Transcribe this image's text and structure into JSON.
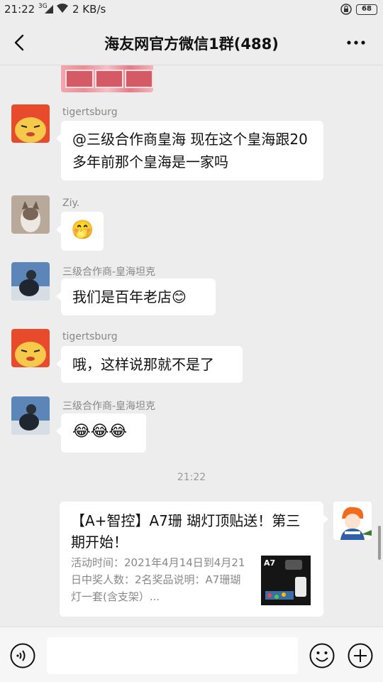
{
  "status_bar": {
    "time": "21:22",
    "network": "3G",
    "speed": "2 KB/s",
    "battery": "68"
  },
  "header": {
    "title": "海友网官方微信1群(488)"
  },
  "messages": [
    {
      "sender": "tigertsburg",
      "text": "@三级合作商皇海  现在这个皇海跟20 多年前那个皇海是一家吗"
    },
    {
      "sender": "Ziy.",
      "text": "🤭"
    },
    {
      "sender": "三级合作商-皇海坦克",
      "text": "我们是百年老店😊"
    },
    {
      "sender": "tigertsburg",
      "text": "哦，这样说那就不是了"
    },
    {
      "sender": "三级合作商-皇海坦克",
      "text": "😂😂😂"
    }
  ],
  "timestamp": "21:22",
  "share_card": {
    "title": "【A+智控】A7珊 瑚灯顶贴送！第三期开始！",
    "description": "活动时间：2021年4月14日到4月21日中奖人数：2名奖品说明：A7珊瑚灯一套(含支架）...",
    "thumb_label": "A7"
  },
  "input_bar": {
    "placeholder": ""
  },
  "icons": {
    "back": "back-arrow-icon",
    "more": "more-dots-icon",
    "voice": "voice-icon",
    "emoji": "emoji-icon",
    "plus": "plus-icon"
  },
  "colors": {
    "background": "#ededed",
    "bubble": "#ffffff",
    "name_text": "#888888"
  }
}
